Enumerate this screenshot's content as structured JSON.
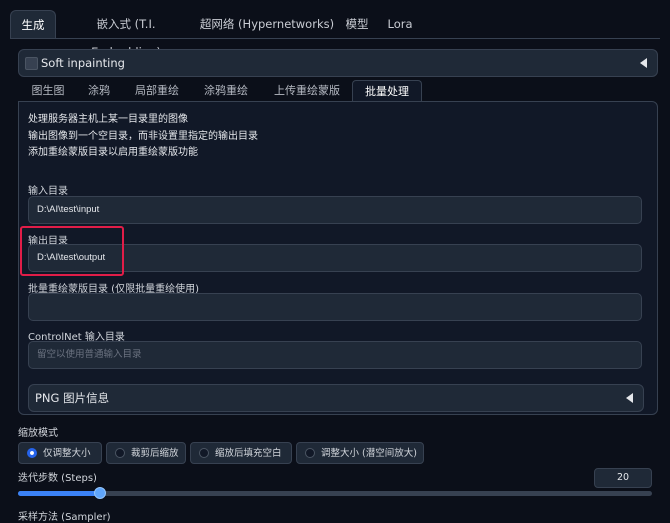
{
  "top_tabs": [
    "生成",
    "嵌入式 (T.I. Embedding)",
    "超网络 (Hypernetworks)",
    "模型",
    "Lora"
  ],
  "soft_inpainting": {
    "label": "Soft inpainting"
  },
  "inner_tabs": [
    "图生图",
    "涂鸦",
    "局部重绘",
    "涂鸦重绘",
    "上传重绘蒙版",
    "批量处理"
  ],
  "batch": {
    "desc": [
      "处理服务器主机上某一目录里的图像",
      "输出图像到一个空目录，而非设置里指定的输出目录",
      "添加重绘蒙版目录以启用重绘蒙版功能"
    ],
    "input_dir": {
      "label": "输入目录",
      "value": "D:\\AI\\test\\input"
    },
    "output_dir": {
      "label": "输出目录",
      "value": "D:\\AI\\test\\output"
    },
    "mask_dir": {
      "label": "批量重绘蒙版目录 (仅限批量重绘使用)",
      "value": ""
    },
    "controlnet_dir": {
      "label": "ControlNet 输入目录",
      "placeholder": "留空以使用普通输入目录"
    },
    "png_info": {
      "label": "PNG 图片信息"
    }
  },
  "resize_mode": {
    "label": "缩放模式",
    "options": [
      "仅调整大小",
      "裁剪后缩放",
      "缩放后填充空白",
      "调整大小 (潜空间放大)"
    ],
    "selected": 0
  },
  "steps": {
    "label": "迭代步数 (Steps)",
    "value": "20",
    "fraction": 0.13
  },
  "sampler": {
    "label": "采样方法 (Sampler)"
  }
}
